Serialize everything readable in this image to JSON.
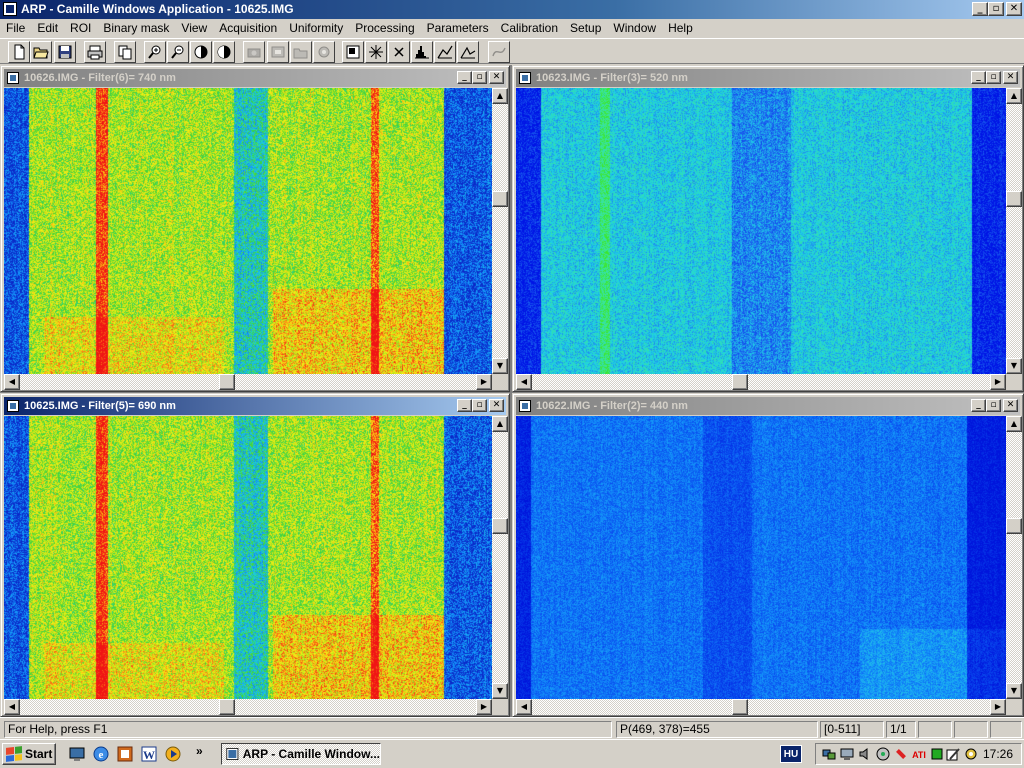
{
  "app": {
    "title": "ARP - Camille Windows Application - 10625.IMG",
    "window_buttons": {
      "minimize": "_",
      "maximize": "▫",
      "close": "✕"
    }
  },
  "menu": [
    "File",
    "Edit",
    "ROI",
    "Binary mask",
    "View",
    "Acquisition",
    "Uniformity",
    "Processing",
    "Parameters",
    "Calibration",
    "Setup",
    "Window",
    "Help"
  ],
  "toolbar": {
    "buttons": [
      {
        "icon": "new-file-icon",
        "enabled": true
      },
      {
        "icon": "open-folder-icon",
        "enabled": true
      },
      {
        "icon": "save-icon",
        "enabled": true
      },
      {
        "icon": "print-icon",
        "enabled": true
      },
      {
        "icon": "copy-icon",
        "enabled": true
      },
      {
        "icon": "zoom-in-icon",
        "enabled": true
      },
      {
        "icon": "zoom-out-icon",
        "enabled": true
      },
      {
        "icon": "contrast-icon",
        "enabled": true
      },
      {
        "icon": "contrast-invert-icon",
        "enabled": true
      },
      {
        "icon": "camera-icon",
        "enabled": false
      },
      {
        "icon": "capture-icon",
        "enabled": false
      },
      {
        "icon": "folder-open-icon",
        "enabled": false
      },
      {
        "icon": "filter-icon",
        "enabled": false
      },
      {
        "icon": "roi-icon",
        "enabled": true
      },
      {
        "icon": "sparkle-icon",
        "enabled": true
      },
      {
        "icon": "x-icon",
        "enabled": true
      },
      {
        "icon": "histogram-icon",
        "enabled": true
      },
      {
        "icon": "profile-icon",
        "enabled": true
      },
      {
        "icon": "line-profile-icon",
        "enabled": true
      },
      {
        "icon": "curve-icon",
        "enabled": false
      }
    ]
  },
  "windows": [
    {
      "title": "10626.IMG - Filter(6)= 740 nm",
      "active": false,
      "palette": "warm"
    },
    {
      "title": "10623.IMG - Filter(3)= 520 nm",
      "active": false,
      "palette": "cyan"
    },
    {
      "title": "10625.IMG - Filter(5)= 690 nm",
      "active": true,
      "palette": "warm"
    },
    {
      "title": "10622.IMG - Filter(2)= 440 nm",
      "active": false,
      "palette": "blue"
    }
  ],
  "status": {
    "help": "For Help, press F1",
    "pixel": "P(469, 378)=455",
    "range": "[0-511]",
    "frame": "1/1"
  },
  "taskbar": {
    "start_label": "Start",
    "more": "»",
    "task_label": "ARP - Camille Window...",
    "lang": "HU",
    "clock": "17:26"
  },
  "colors": {
    "title_active": "#0a246a",
    "title_inactive": "#808080",
    "face": "#d4d0c8"
  }
}
